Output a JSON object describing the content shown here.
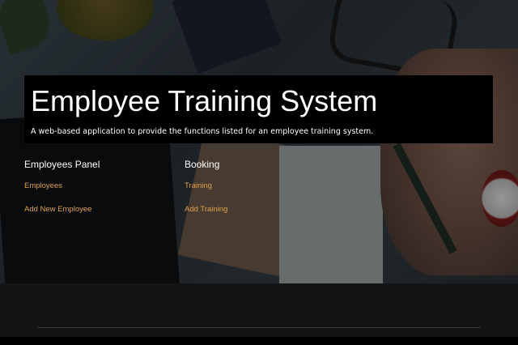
{
  "header": {
    "title": "Employee Training System",
    "subtitle": "A web-based application to provide the functions listed for an employee training system."
  },
  "employees_panel": {
    "heading": "Employees Panel",
    "links": [
      "Employees",
      "Add New Employee"
    ]
  },
  "booking_panel": {
    "heading": "Booking",
    "links": [
      "Training",
      "Add Training"
    ]
  },
  "colors": {
    "link": "#e0a04a",
    "banner": "#000000",
    "footer": "#141414"
  }
}
